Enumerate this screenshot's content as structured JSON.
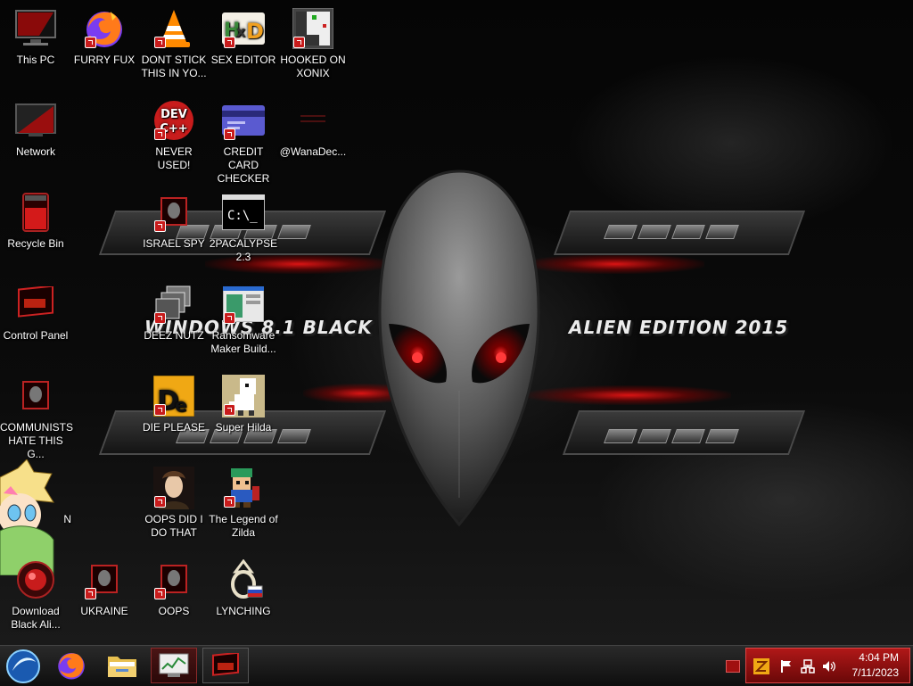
{
  "wallpaper": {
    "left_text": "WINDOWS 8.1 BLACK PRO",
    "right_text": "ALIEN EDITION 2015"
  },
  "desktop_icons": [
    {
      "id": "this-pc",
      "label": "This PC"
    },
    {
      "id": "furry-fux",
      "label": "FURRY FUX"
    },
    {
      "id": "dont-stick",
      "label": "DONT STICK\nTHIS IN YO..."
    },
    {
      "id": "sex-editor",
      "label": "SEX EDITOR"
    },
    {
      "id": "hooked-on-xonix",
      "label": "HOOKED ON\nXONIX"
    },
    {
      "id": "network",
      "label": "Network"
    },
    {
      "id": "never-used",
      "label": "NEVER USED!",
      "badge": "DEV\nC++"
    },
    {
      "id": "credit-card-checker",
      "label": "CREDIT CARD\nCHECKER"
    },
    {
      "id": "wanadec",
      "label": "@WanaDec..."
    },
    {
      "id": "recycle-bin",
      "label": "Recycle Bin"
    },
    {
      "id": "israel-spy",
      "label": "ISRAEL SPY"
    },
    {
      "id": "2pacalypse",
      "label": "2PACALYPSE\n2.3",
      "badge": "C:\\_"
    },
    {
      "id": "control-panel",
      "label": "Control Panel"
    },
    {
      "id": "deez-nutz",
      "label": "DEEZ NUTZ"
    },
    {
      "id": "ransomware-maker",
      "label": "Ransomware\nMaker Build..."
    },
    {
      "id": "communists",
      "label": "COMMUNISTS\nHATE THIS G..."
    },
    {
      "id": "die-please",
      "label": "DIE PLEASE",
      "badge": "De"
    },
    {
      "id": "super-hilda",
      "label": "Super Hilda"
    },
    {
      "id": "oops-did-i",
      "label": "OOPS DID I\nDO THAT"
    },
    {
      "id": "legend-of-zilda",
      "label": "The Legend of\nZilda"
    },
    {
      "id": "star-partial",
      "label": "N"
    },
    {
      "id": "download-black-ali",
      "label": "Download\nBlack Ali..."
    },
    {
      "id": "ukraine",
      "label": "UKRAINE"
    },
    {
      "id": "oops",
      "label": "OOPS"
    },
    {
      "id": "lynching",
      "label": "LYNCHING"
    }
  ],
  "taskbar": {
    "pinned": [
      "start-orb",
      "firefox",
      "file-explorer",
      "task-manager",
      "alien-app"
    ],
    "clock_time": "4:04 PM",
    "clock_date": "7/11/2023"
  },
  "colors": {
    "accent": "#c81c1c",
    "tray": "#a01414"
  }
}
